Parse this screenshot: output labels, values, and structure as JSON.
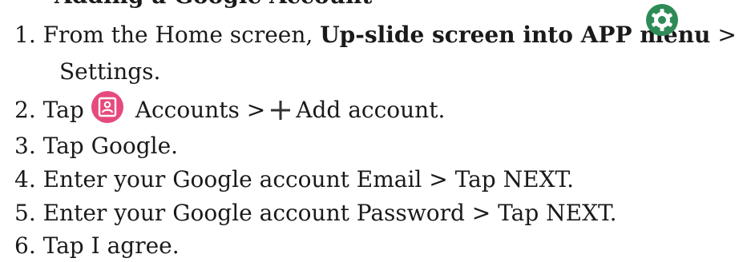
{
  "header_partial": "Adding a Google Account",
  "steps": {
    "s1": {
      "num": "1.",
      "before": "From the Home screen,",
      "bold": "Up-slide screen into APP menu",
      "after": ">",
      "cont": "Settings."
    },
    "s2": {
      "num": "2.",
      "tap": "Tap",
      "accounts": "Accounts >",
      "add": "Add account."
    },
    "s3": {
      "text": "3. Tap Google."
    },
    "s4": {
      "text": "4. Enter your Google account Email > Tap NEXT."
    },
    "s5": {
      "text": "5. Enter your Google account Password > Tap NEXT."
    },
    "s6": {
      "text": "6. Tap I agree."
    }
  },
  "icons": {
    "settings": "gear-icon",
    "accounts": "accounts-icon",
    "add": "plus-icon"
  },
  "colors": {
    "settings_icon": "#2e8b57",
    "accounts_icon": "#e64a7c",
    "text": "#1a1a1a"
  }
}
